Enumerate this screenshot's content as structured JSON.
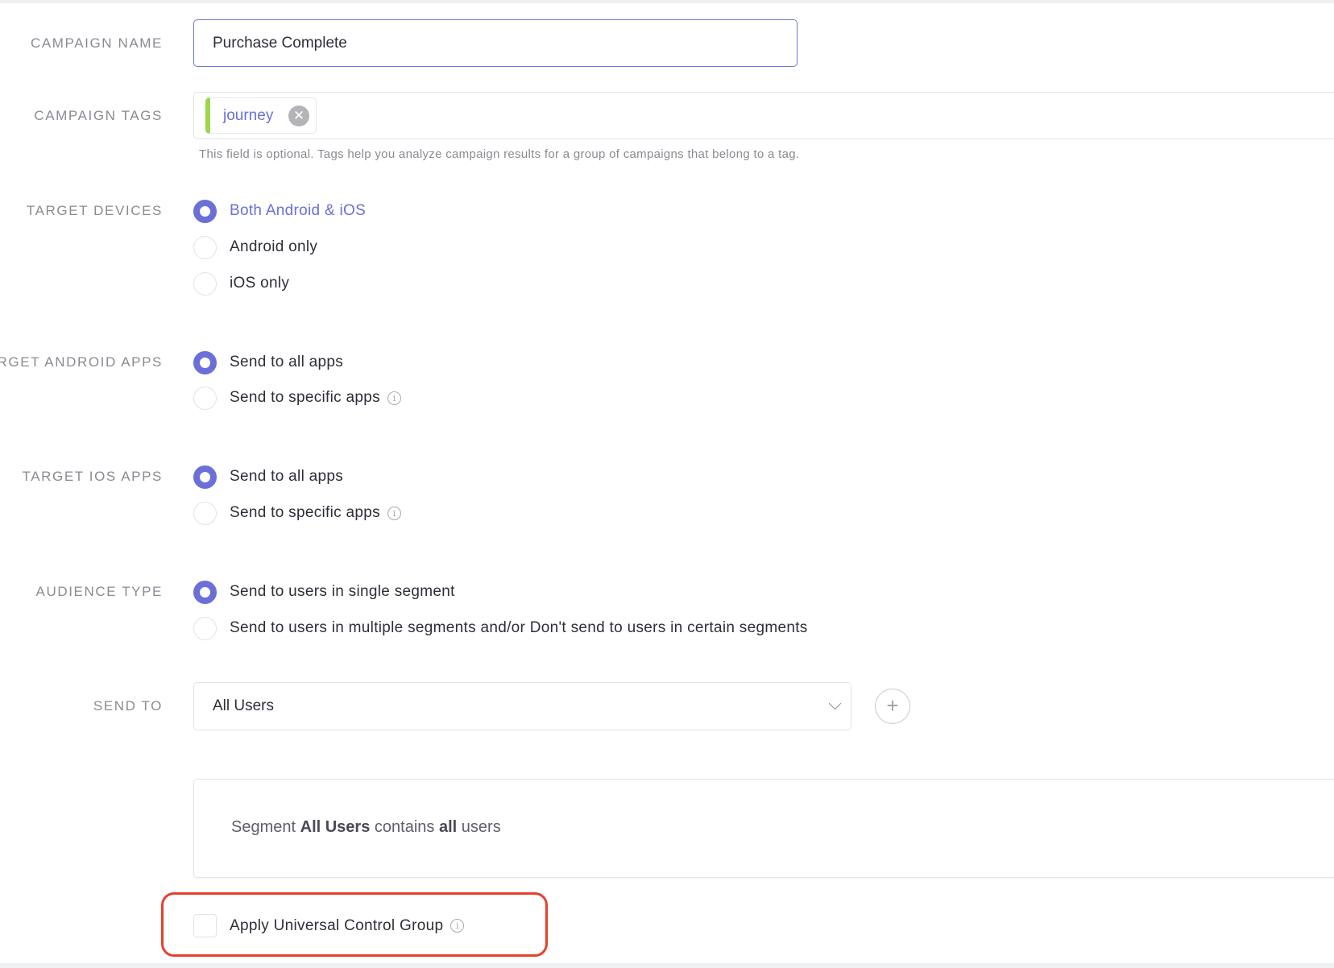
{
  "campaign_name": {
    "label": "CAMPAIGN NAME",
    "value": "Purchase Complete"
  },
  "campaign_tags": {
    "label": "CAMPAIGN TAGS",
    "tags": [
      {
        "text": "journey",
        "color": "#9ed64a"
      }
    ],
    "help": "This field is optional. Tags help you analyze campaign results for a group of campaigns that belong to a tag."
  },
  "target_devices": {
    "label": "TARGET DEVICES",
    "options": [
      "Both Android & iOS",
      "Android only",
      "iOS only"
    ],
    "selected": 0
  },
  "target_android_apps": {
    "label": "TARGET ANDROID APPS",
    "options": [
      "Send to all apps",
      "Send to specific apps"
    ],
    "selected": 0
  },
  "target_ios_apps": {
    "label": "TARGET IOS APPS",
    "options": [
      "Send to all apps",
      "Send to specific apps"
    ],
    "selected": 0
  },
  "audience_type": {
    "label": "AUDIENCE TYPE",
    "options": [
      "Send to users in single segment",
      "Send to users in multiple segments and/or Don't send to users in certain segments"
    ],
    "selected": 0
  },
  "send_to": {
    "label": "SEND TO",
    "value": "All Users",
    "add": "+"
  },
  "segment_summary": {
    "prefix": "Segment",
    "name": "All Users",
    "middle": "contains",
    "scope": "all",
    "suffix": "users"
  },
  "ucg": {
    "label": "Apply Universal Control Group",
    "checked": false
  },
  "colors": {
    "accent": "#6b6fd8",
    "highlight": "#e8402a",
    "tag": "#9ed64a"
  }
}
